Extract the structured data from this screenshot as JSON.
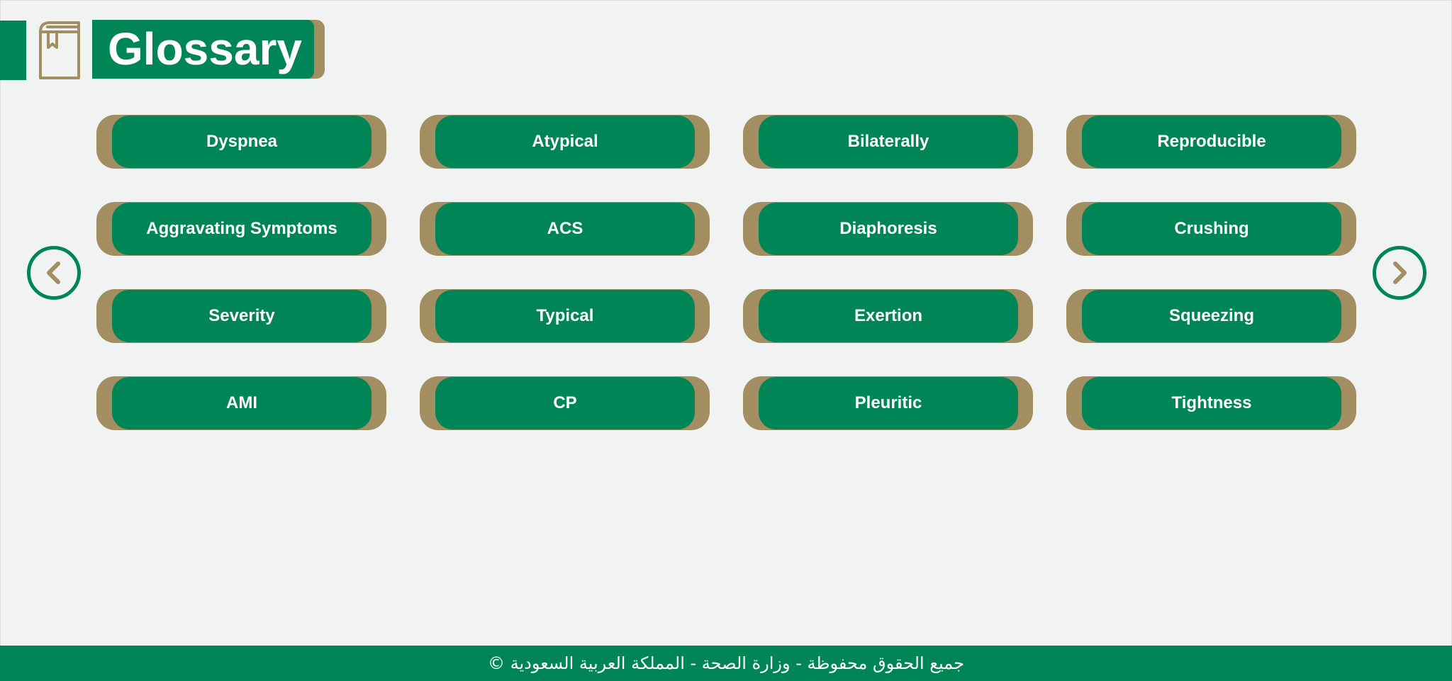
{
  "header": {
    "title": "Glossary",
    "icon": "book-icon"
  },
  "terms": [
    "Dyspnea",
    "Atypical",
    "Bilaterally",
    "Reproducible",
    "Aggravating Symptoms",
    "ACS",
    "Diaphoresis",
    "Crushing",
    "Severity",
    "Typical",
    "Exertion",
    "Squeezing",
    "AMI",
    "CP",
    "Pleuritic",
    "Tightness"
  ],
  "navigation": {
    "prev_icon": "chevron-left-icon",
    "next_icon": "chevron-right-icon"
  },
  "footer": {
    "text": "جميع الحقوق محفوظة - وزارة الصحة - المملكة العربية السعودية ©"
  },
  "colors": {
    "primary_green": "#008556",
    "gold": "#a38e61",
    "background": "#f1f3f2"
  }
}
